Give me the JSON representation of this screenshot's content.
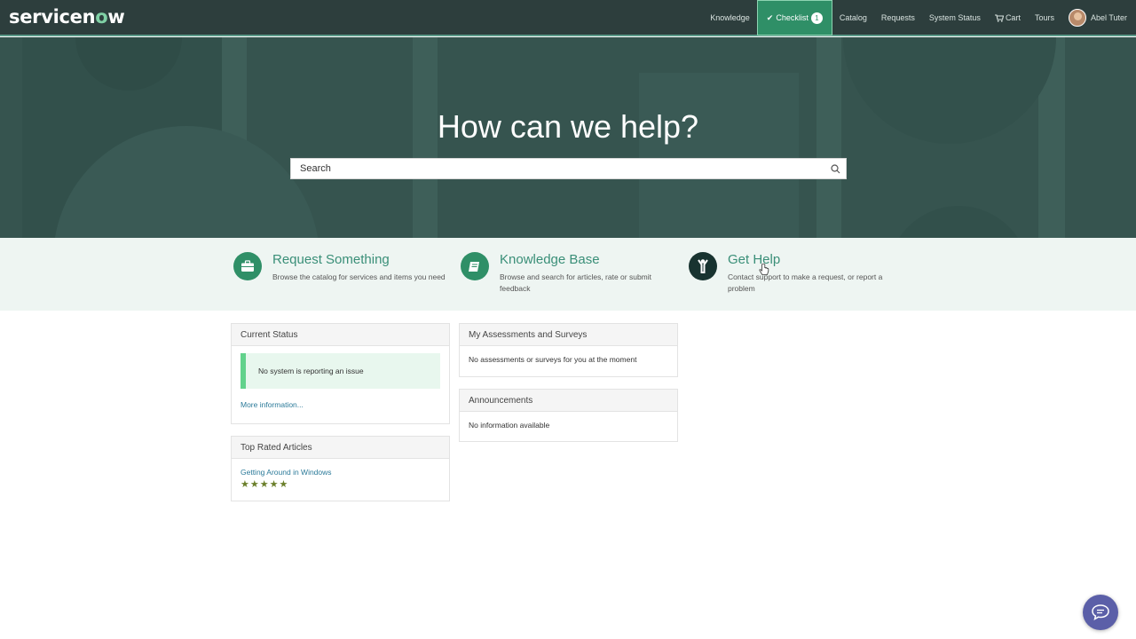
{
  "header": {
    "logo_text_a": "servicen",
    "logo_text_o": "o",
    "logo_text_b": "w",
    "nav": {
      "knowledge": "Knowledge",
      "checklist": "Checklist",
      "checklist_count": "1",
      "catalog": "Catalog",
      "requests": "Requests",
      "system_status": "System Status",
      "cart": "Cart",
      "tours": "Tours",
      "user_name": "Abel Tuter"
    }
  },
  "hero": {
    "title": "How can we help?",
    "search_placeholder": "Search"
  },
  "tiles": [
    {
      "title": "Request Something",
      "desc": "Browse the catalog for services and items you need",
      "icon": "briefcase-icon"
    },
    {
      "title": "Knowledge Base",
      "desc": "Browse and search for articles, rate or submit feedback",
      "icon": "book-icon"
    },
    {
      "title": "Get Help",
      "desc": "Contact support to make a request, or report a problem",
      "icon": "person-help-icon"
    }
  ],
  "panels": {
    "current_status": {
      "title": "Current Status",
      "message": "No system is reporting an issue",
      "more_link": "More information..."
    },
    "top_rated": {
      "title": "Top Rated Articles",
      "article": "Getting Around in Windows",
      "rating": 5
    },
    "assessments": {
      "title": "My Assessments and Surveys",
      "message": "No assessments or surveys for you at the moment"
    },
    "announcements": {
      "title": "Announcements",
      "message": "No information available"
    }
  },
  "colors": {
    "header_bg": "#2d3e3d",
    "accent": "#2f8f67",
    "hero_bg": "#36544f",
    "tile_title": "#3a8f78",
    "chat_button": "#5b5fa8"
  }
}
